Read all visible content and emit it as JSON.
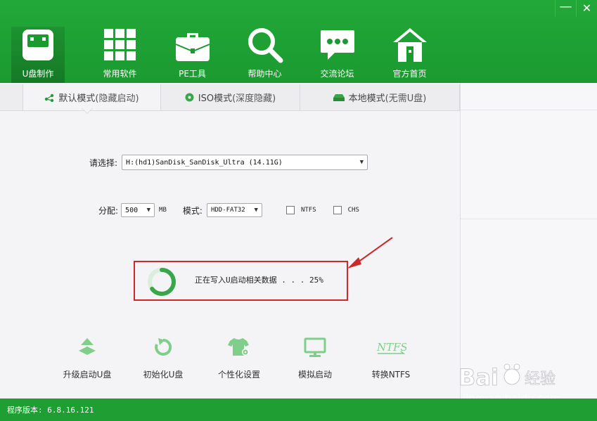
{
  "window": {
    "minimize_label": "—",
    "close_label": "✕"
  },
  "nav": {
    "items": [
      {
        "label": "U盘制作",
        "icon": "usb-drive-icon",
        "active": true
      },
      {
        "label": "常用软件",
        "icon": "apps-grid-icon"
      },
      {
        "label": "PE工具",
        "icon": "toolbox-icon"
      },
      {
        "label": "帮助中心",
        "icon": "search-icon"
      },
      {
        "label": "交流论坛",
        "icon": "chat-bubble-icon"
      },
      {
        "label": "官方首页",
        "icon": "home-icon"
      }
    ]
  },
  "tabs": [
    {
      "title": "默认模式",
      "sub": "(隐藏启动)",
      "icon": "share-nodes-icon",
      "active": true
    },
    {
      "title": "ISO模式",
      "sub": "(深度隐藏)",
      "icon": "disc-icon"
    },
    {
      "title": "本地模式",
      "sub": "(无需U盘)",
      "icon": "drive-icon"
    }
  ],
  "device": {
    "label": "请选择:",
    "value": "H:(hd1)SanDisk_SanDisk_Ultra (14.11G)"
  },
  "options": {
    "alloc_label": "分配:",
    "alloc_value": "500",
    "alloc_unit": "MB",
    "mode_label": "模式:",
    "mode_value": "HDD-FAT32",
    "ntfs_label": "NTFS",
    "chs_label": "CHS",
    "ntfs_checked": false,
    "chs_checked": false
  },
  "progress": {
    "text": "正在写入U启动相关数据 . . . 25%",
    "percent": 25
  },
  "tools": [
    {
      "label": "升级启动U盘",
      "icon": "upgrade-icon"
    },
    {
      "label": "初始化U盘",
      "icon": "reset-icon"
    },
    {
      "label": "个性化设置",
      "icon": "tshirt-gear-icon"
    },
    {
      "label": "模拟启动",
      "icon": "monitor-icon"
    },
    {
      "label": "转换NTFS",
      "icon": "ntfs-icon"
    }
  ],
  "watermark": {
    "brand": "Bai  经验",
    "url": "jingyan.baidu.com"
  },
  "status": {
    "version": "程序版本: 6.8.16.121"
  },
  "colors": {
    "brand_green": "#1b9a30",
    "highlight_red": "#cc2a2a",
    "tool_green": "#7fcf8b"
  }
}
